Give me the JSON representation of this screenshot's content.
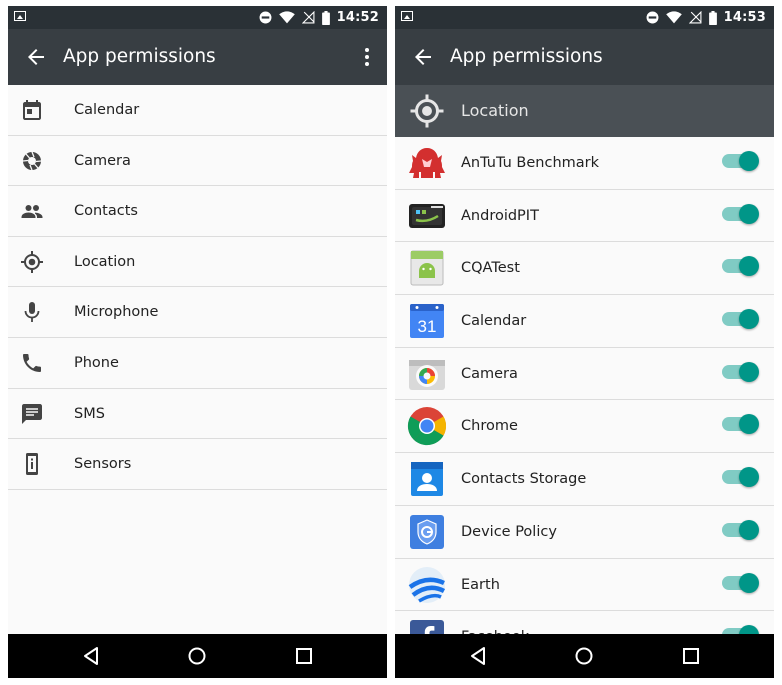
{
  "left_screen": {
    "status": {
      "time": "14:52"
    },
    "appbar": {
      "title": "App permissions"
    },
    "permissions": [
      {
        "label": "Calendar",
        "icon": "calendar-icon"
      },
      {
        "label": "Camera",
        "icon": "camera-icon"
      },
      {
        "label": "Contacts",
        "icon": "contacts-icon"
      },
      {
        "label": "Location",
        "icon": "location-icon"
      },
      {
        "label": "Microphone",
        "icon": "microphone-icon"
      },
      {
        "label": "Phone",
        "icon": "phone-icon"
      },
      {
        "label": "SMS",
        "icon": "sms-icon"
      },
      {
        "label": "Sensors",
        "icon": "sensors-icon"
      }
    ]
  },
  "right_screen": {
    "status": {
      "time": "14:53"
    },
    "appbar": {
      "title": "App permissions"
    },
    "section": {
      "label": "Location",
      "icon": "location-icon"
    },
    "apps": [
      {
        "label": "AnTuTu Benchmark",
        "icon": "antutu-icon",
        "enabled": true
      },
      {
        "label": "AndroidPIT",
        "icon": "androidpit-icon",
        "enabled": true
      },
      {
        "label": "CQATest",
        "icon": "cqatest-icon",
        "enabled": true
      },
      {
        "label": "Calendar",
        "icon": "calendar-app-icon",
        "icon_text": "31",
        "enabled": true
      },
      {
        "label": "Camera",
        "icon": "camera-app-icon",
        "enabled": true
      },
      {
        "label": "Chrome",
        "icon": "chrome-icon",
        "enabled": true
      },
      {
        "label": "Contacts Storage",
        "icon": "contacts-storage-icon",
        "enabled": true
      },
      {
        "label": "Device Policy",
        "icon": "device-policy-icon",
        "enabled": true
      },
      {
        "label": "Earth",
        "icon": "earth-icon",
        "enabled": true
      },
      {
        "label": "Facebook",
        "icon": "facebook-icon",
        "enabled": true
      }
    ]
  },
  "colors": {
    "status_bar": "#2a3136",
    "app_bar": "#383e43",
    "section_header": "#4a5055",
    "toggle_thumb": "#009688",
    "toggle_track": "#80cbc4",
    "nav_bar": "#000000"
  }
}
